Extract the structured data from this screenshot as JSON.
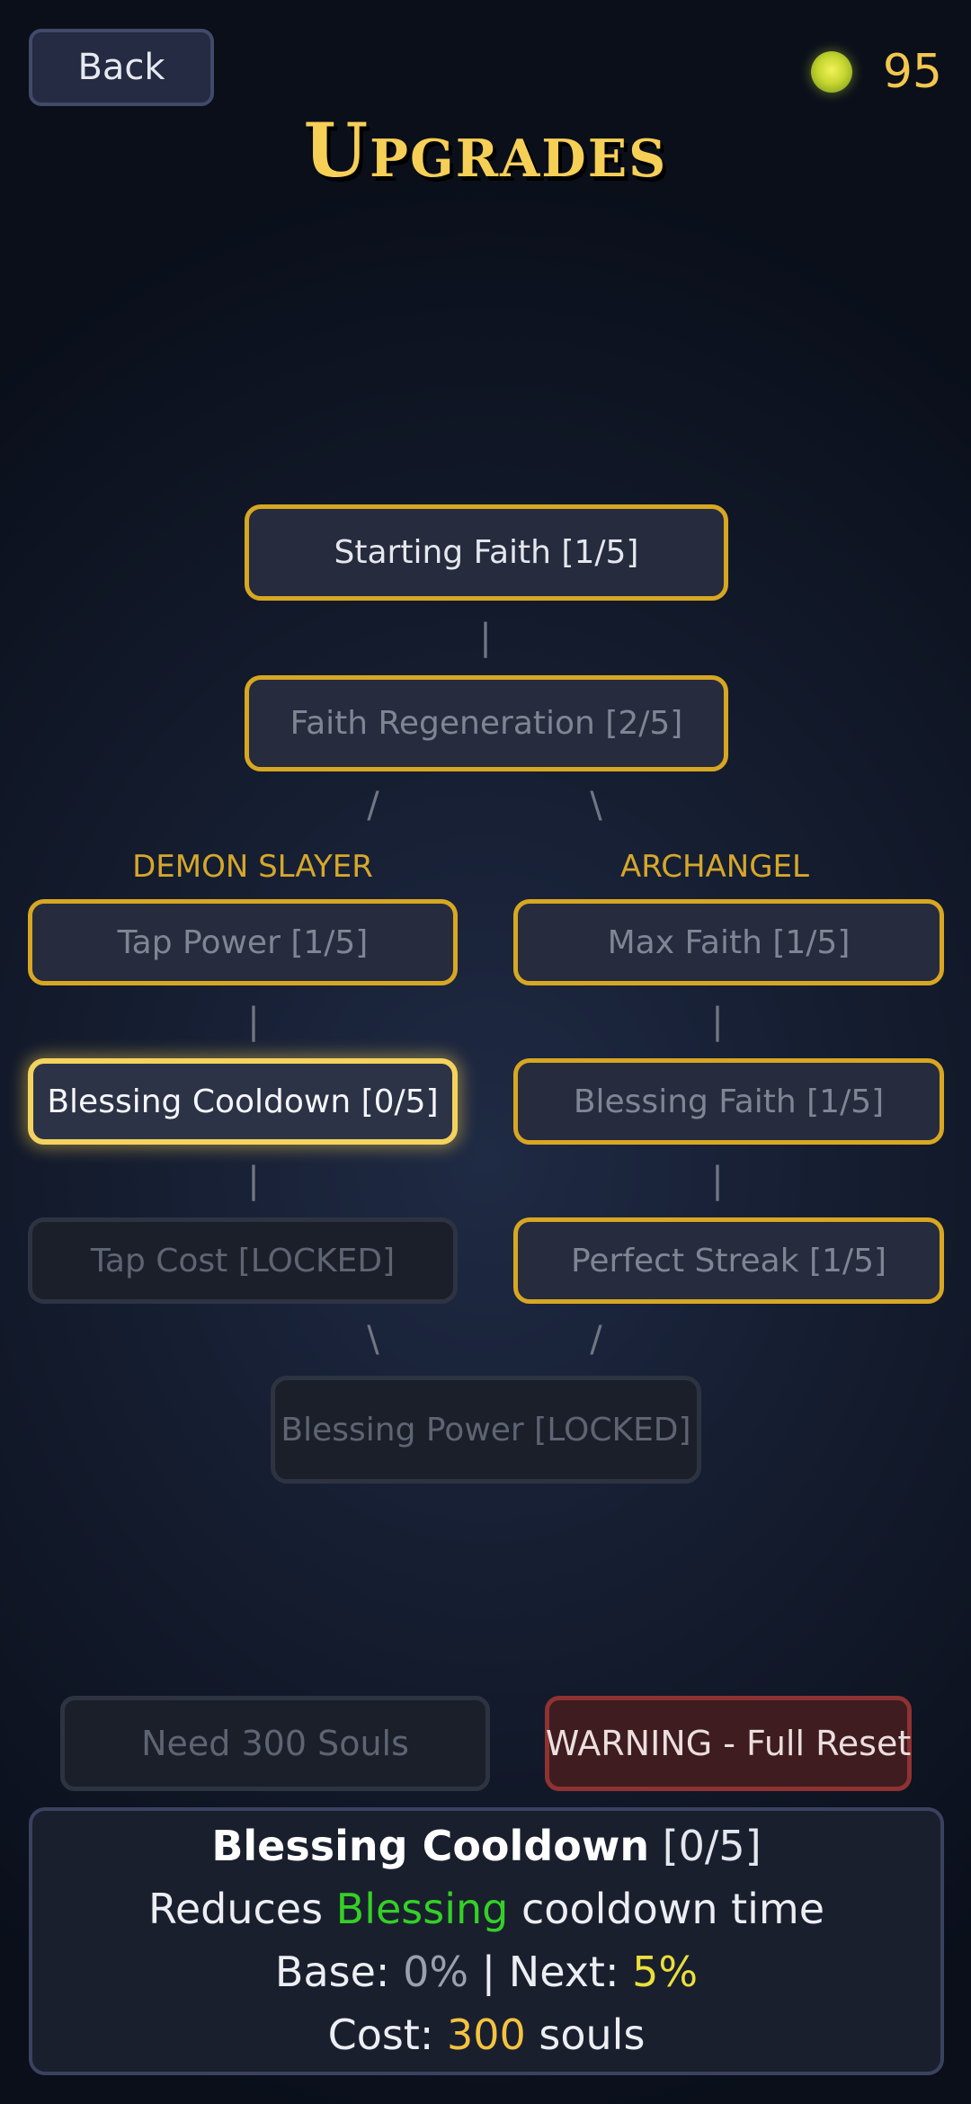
{
  "header": {
    "back_label": "Back",
    "currency_icon": "soul-orb-icon",
    "currency_value": "95",
    "title": "Upgrades"
  },
  "tree": {
    "branches": {
      "left": "DEMON SLAYER",
      "right": "ARCHANGEL"
    },
    "connectors": {
      "vertical": "|",
      "slash": "/",
      "backslash": "\\"
    },
    "nodes": {
      "starting_faith": {
        "label": "Starting Faith [1/5]",
        "state": "owned"
      },
      "faith_regeneration": {
        "label": "Faith Regeneration [2/5]",
        "state": "owned"
      },
      "tap_power": {
        "label": "Tap Power [1/5]",
        "state": "owned"
      },
      "max_faith": {
        "label": "Max Faith [1/5]",
        "state": "owned"
      },
      "blessing_cooldown": {
        "label": "Blessing Cooldown [0/5]",
        "state": "selected"
      },
      "blessing_faith": {
        "label": "Blessing Faith [1/5]",
        "state": "owned"
      },
      "tap_cost": {
        "label": "Tap Cost [LOCKED]",
        "state": "locked"
      },
      "perfect_streak": {
        "label": "Perfect Streak [1/5]",
        "state": "owned"
      },
      "blessing_power": {
        "label": "Blessing Power [LOCKED]",
        "state": "locked"
      }
    }
  },
  "actions": {
    "need_label": "Need 300 Souls",
    "reset_label": "WARNING - Full Reset"
  },
  "info": {
    "name": "Blessing Cooldown",
    "level": "[0/5]",
    "desc_prefix": "Reduces",
    "desc_highlight": "Blessing",
    "desc_suffix": "cooldown time",
    "base_label": "Base:",
    "base_value": "0%",
    "separator": "|",
    "next_label": "Next:",
    "next_value": "5%",
    "cost_label": "Cost:",
    "cost_value": "300",
    "cost_unit": "souls"
  },
  "colors": {
    "gold_border": "#d8a722",
    "selected_border": "#f3d35d",
    "danger": "#8e3232",
    "highlight_green": "#34d026",
    "currency_text": "#f3c64f"
  }
}
